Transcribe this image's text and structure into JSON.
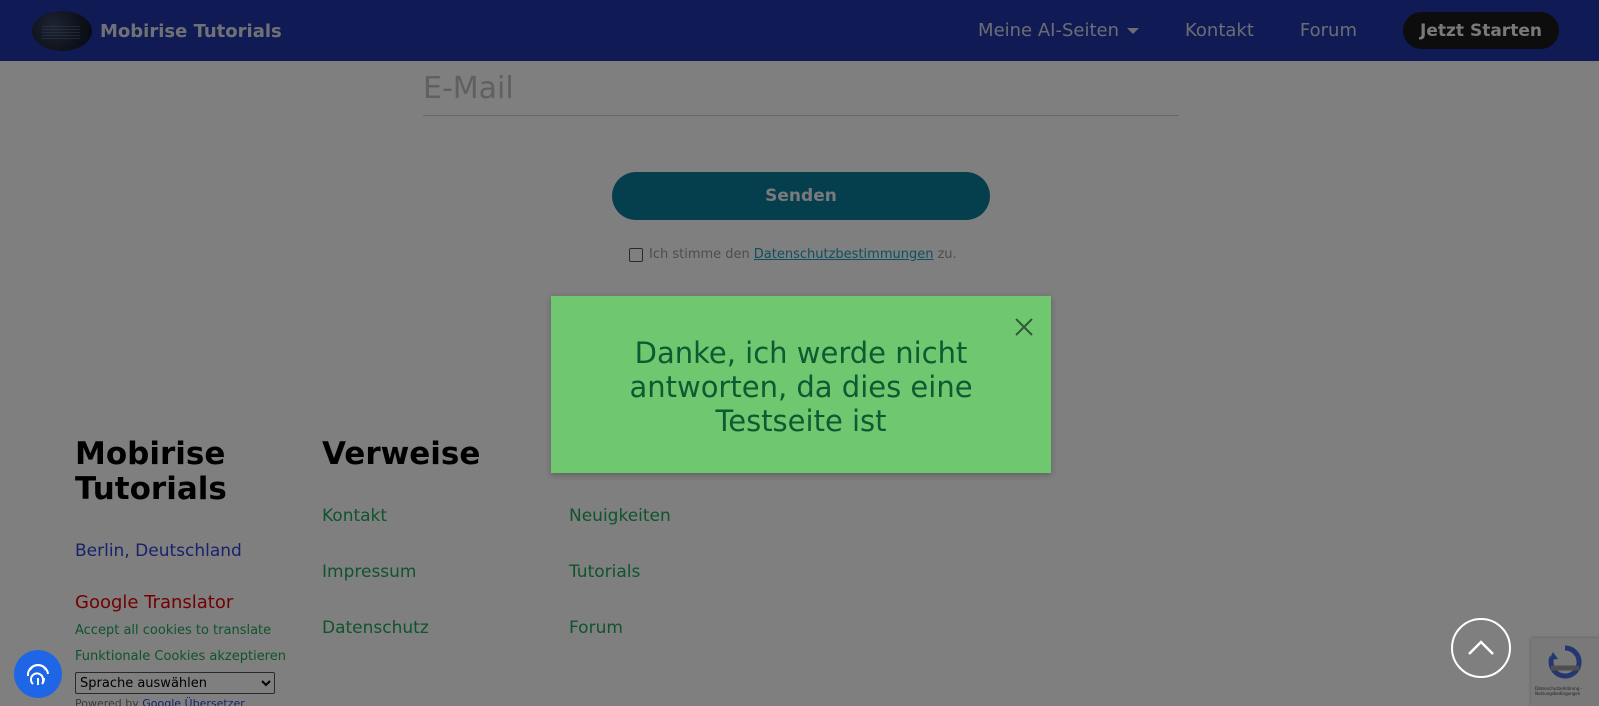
{
  "navbar": {
    "brand_name": "Mobirise Tutorials",
    "links": [
      "Meine AI-Seiten",
      "Kontakt",
      "Forum"
    ],
    "cta_label": "Jetzt Starten"
  },
  "form": {
    "email_placeholder": "E-Mail",
    "send_label": "Senden",
    "consent_prefix": "Ich stimme den",
    "consent_link": "Datenschutzbestimmungen",
    "consent_suffix": "zu."
  },
  "toast": {
    "message": "Danke, ich werde nicht antworten, da dies eine Testseite ist",
    "close_icon": "close-icon"
  },
  "footer": {
    "col1": {
      "title": "Mobirise Tutorials",
      "city": "Berlin, Deutschland",
      "translator_title": "Google Translator",
      "translator_accept": "Accept all cookies to translate",
      "translator_functional": "Funktionale Cookies akzeptieren",
      "language_select": "Sprache auswählen",
      "powered_prefix": "Powered by",
      "powered_link": "Google Übersetzer"
    },
    "col2": {
      "title": "Verweise",
      "links": [
        "Kontakt",
        "Impressum",
        "Datenschutz"
      ]
    },
    "col3": {
      "links": [
        "Neuigkeiten",
        "Tutorials",
        "Forum"
      ]
    }
  },
  "widgets": {
    "fingerprint_icon": "fingerprint-icon",
    "scroll_top_icon": "chevron-up-icon",
    "recaptcha_text": "Datenschutzerklärung - Nutzungsbedingungen"
  },
  "colors": {
    "navbar": "#2137aa",
    "send_button": "#0a7c9a",
    "toast_bg": "#6fc76f",
    "toast_text": "#0e5a32",
    "footer_links": "#1ea85a",
    "translator_title": "#e60000"
  }
}
